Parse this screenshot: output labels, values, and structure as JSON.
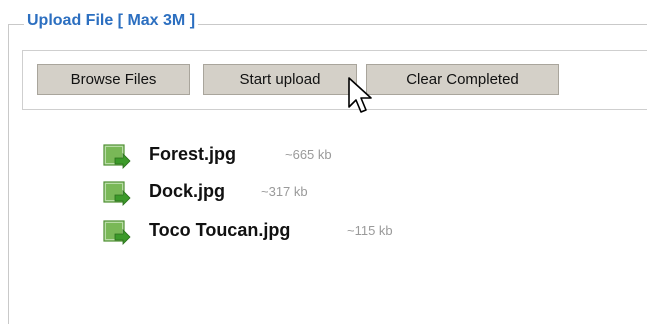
{
  "upload_panel": {
    "legend": "Upload File [ Max 3M ]"
  },
  "toolbar": {
    "browse_label": "Browse Files",
    "start_label": "Start upload",
    "clear_label": "Clear Completed"
  },
  "files": [
    {
      "name": "Forest.jpg",
      "size": "~665 kb",
      "icon": "image-file-icon"
    },
    {
      "name": "Dock.jpg",
      "size": "~317 kb",
      "icon": "image-file-icon"
    },
    {
      "name": "Toco Toucan.jpg",
      "size": "~115 kb",
      "icon": "image-file-icon"
    }
  ],
  "colors": {
    "legend_text": "#2c6fc0",
    "button_face": "#d4d0c8",
    "size_text": "#9a9a9a",
    "icon_green": "#5aa83a"
  }
}
